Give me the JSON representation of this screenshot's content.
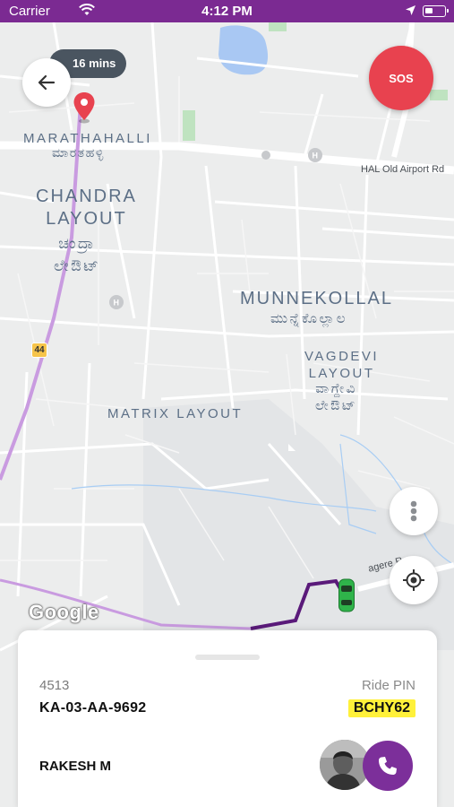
{
  "status_bar": {
    "carrier": "Carrier",
    "time": "4:12 PM"
  },
  "map": {
    "eta": "16 mins",
    "areas": {
      "marathahalli": "MARATHAHALLI",
      "marathahalli_kn": "ಮಾರತಹಳ್ಳಿ",
      "chandra_layout": "CHANDRA\nLAYOUT",
      "chandra_layout_kn": "ಚಂದ್ರಾ\nಲೇಔಟ್",
      "munnekollal": "MUNNEKOLLAL",
      "munnekollal_kn": "ಮುನ್ನೆಕೊಲ್ಲಾಲ",
      "vagdevi_layout": "VAGDEVI\nLAYOUT",
      "vagdevi_layout_kn": "ವಾಗ್ದೇವಿ\nಲೇಔಟ್",
      "matrix_layout": "MATRIX LAYOUT"
    },
    "roads": {
      "hal_old_airport": "HAL Old Airport Rd",
      "highway_shield": "44",
      "partial_road": "agere R"
    },
    "attribution": "Google"
  },
  "buttons": {
    "sos": "SOS"
  },
  "ride": {
    "vehicle_model": "4513",
    "plate": "KA-03-AA-9692",
    "pin_label": "Ride PIN",
    "pin": "BCHY62",
    "driver_name": "RAKESH M"
  },
  "colors": {
    "brand_purple": "#7b2a92",
    "sos_red": "#e8424f",
    "pin_highlight": "#fff13a",
    "route_purple": "#5a1a7a",
    "car_green": "#2fb34a"
  },
  "icons": {
    "back": "arrow-left-icon",
    "traffic": "traffic-light-icon",
    "locate": "crosshair-icon",
    "call": "phone-icon",
    "pin": "map-pin-icon",
    "car": "car-icon"
  }
}
